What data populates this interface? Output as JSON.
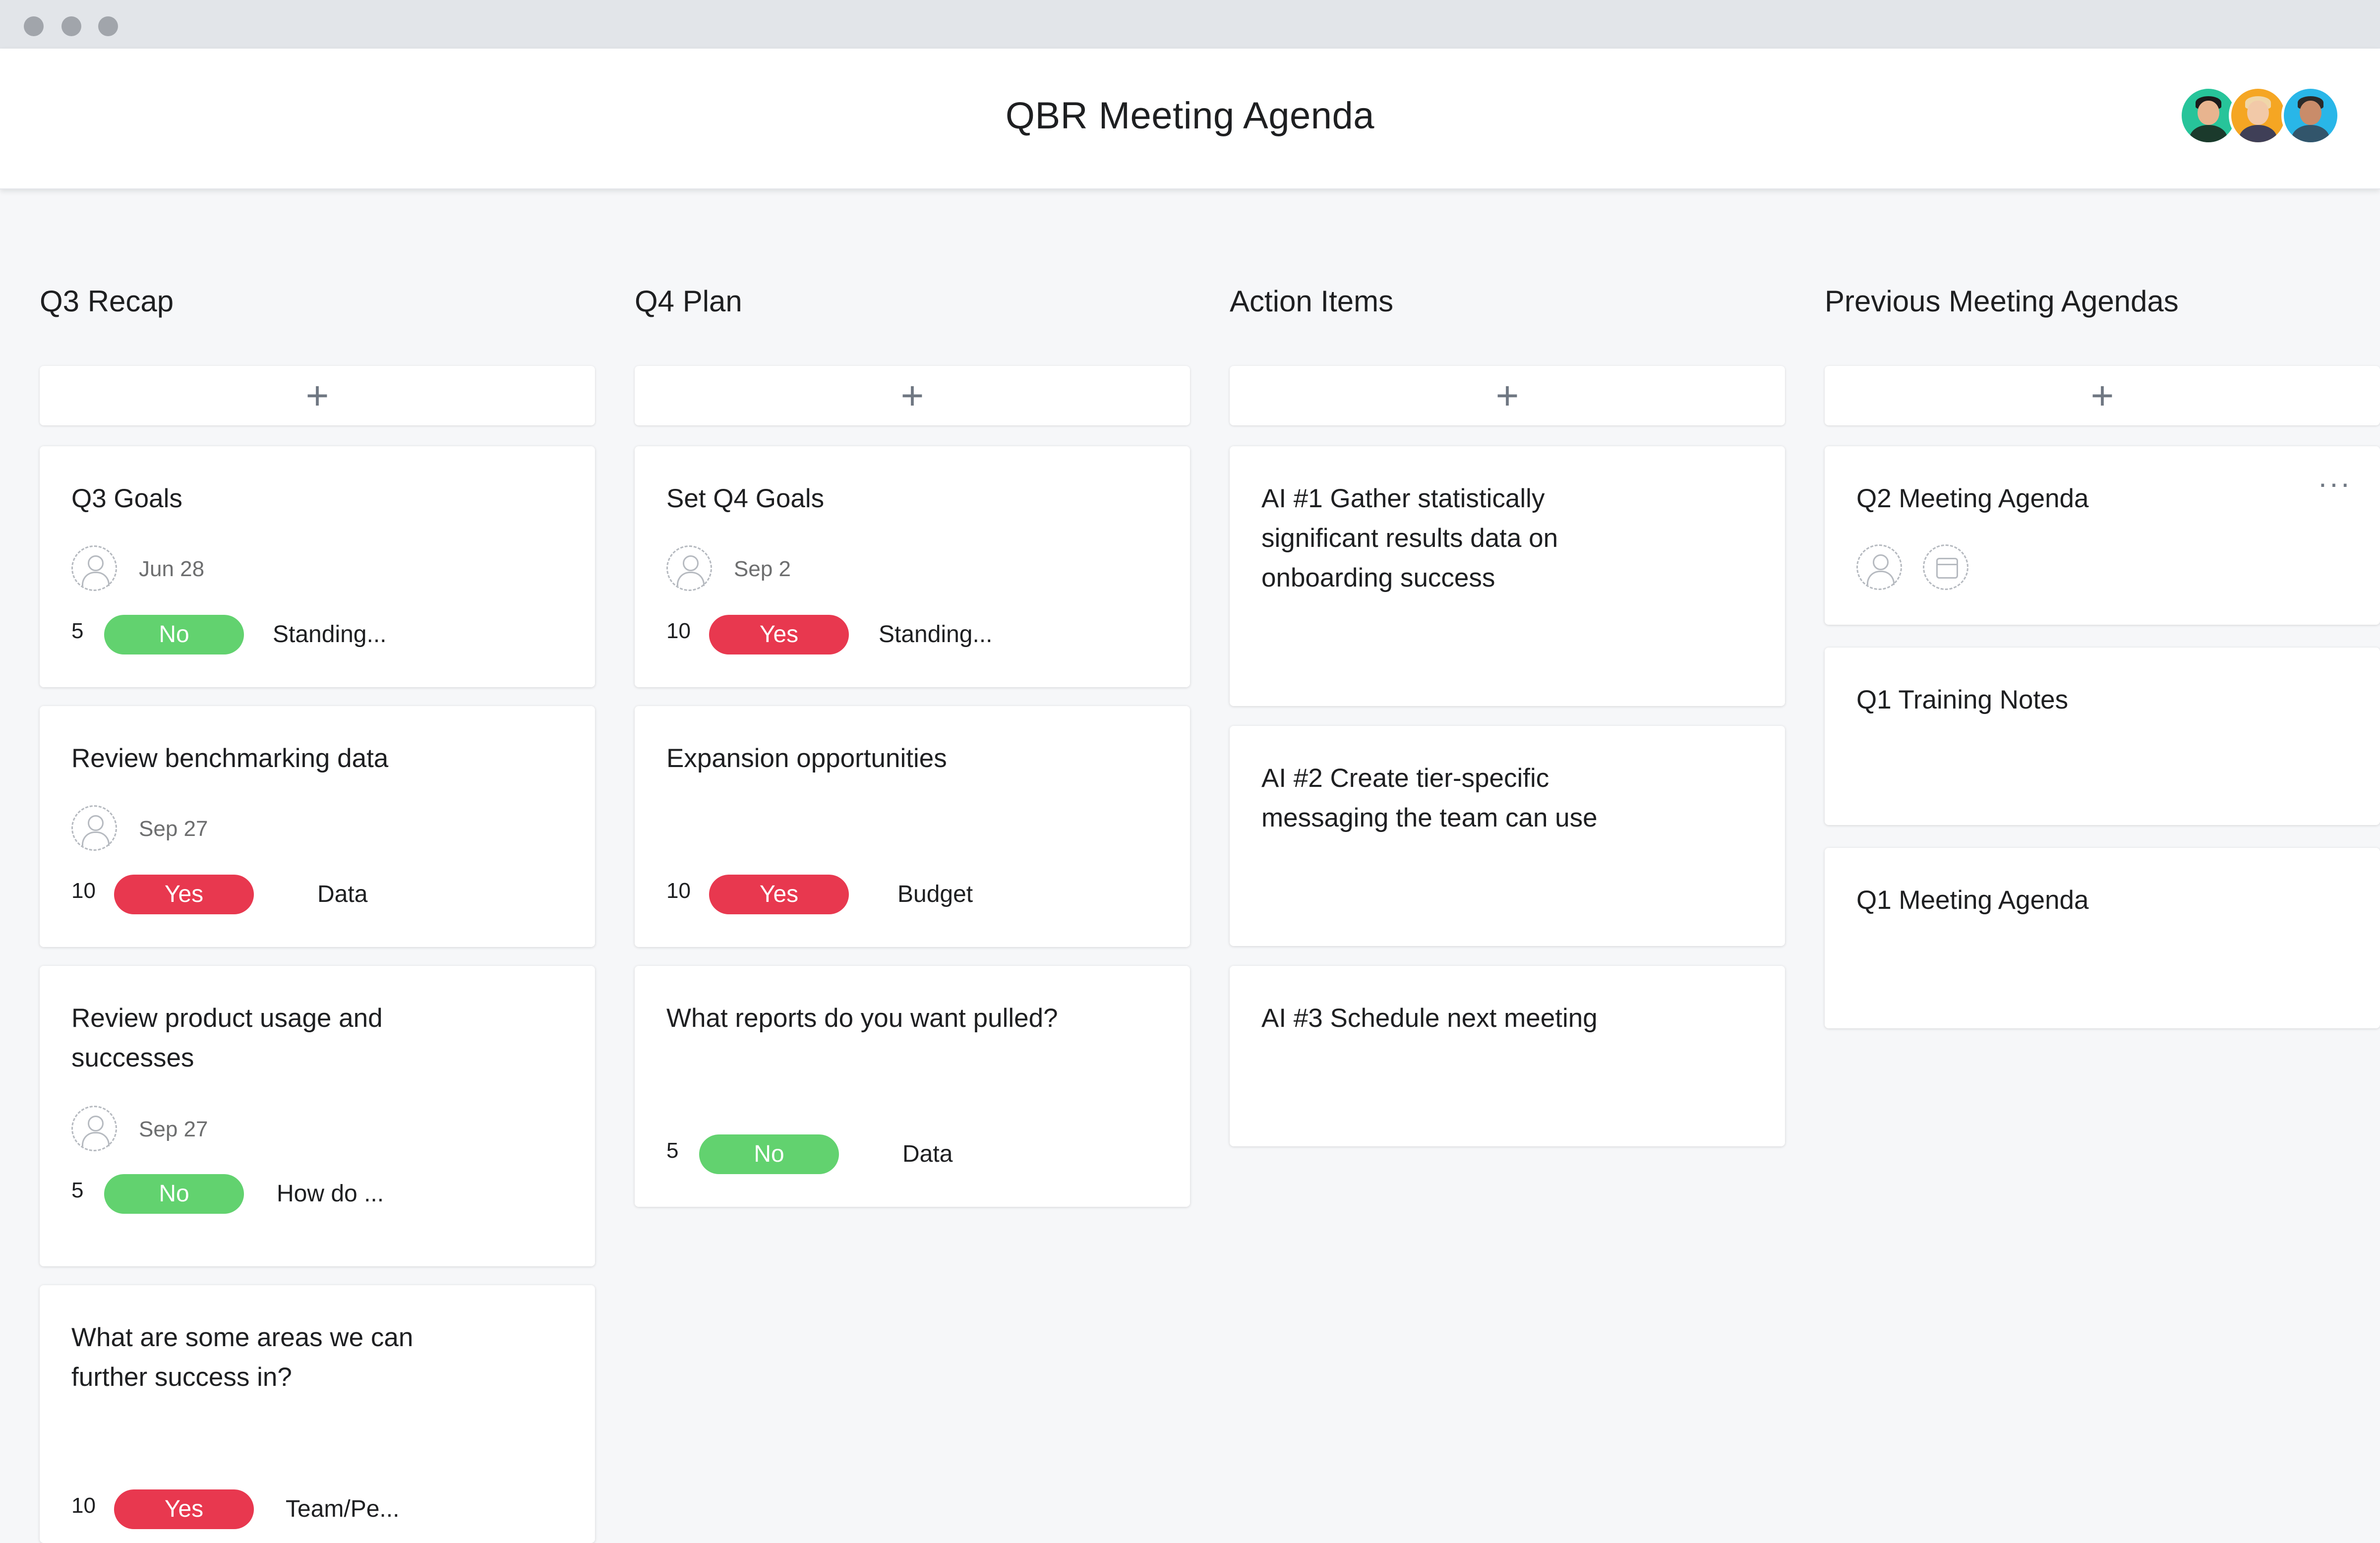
{
  "app": {
    "title": "QBR Meeting Agenda"
  },
  "header": {
    "avatars": [
      {
        "name": "avatar-1",
        "bg": "#27c49a",
        "hair": "#1b1b1b"
      },
      {
        "name": "avatar-2",
        "bg": "#f5a623",
        "hair": "#f0d6a8"
      },
      {
        "name": "avatar-3",
        "bg": "#29b6e8",
        "hair": "#2a2a2a"
      }
    ]
  },
  "add_label": "+",
  "columns": [
    {
      "title": "Q3 Recap",
      "cards": [
        {
          "title": "Q3 Goals",
          "date": "Jun 28",
          "num": "5",
          "pill": "No",
          "tag": "Standing..."
        },
        {
          "title": "Review benchmarking data",
          "date": "Sep 27",
          "num": "10",
          "pill": "Yes",
          "tag": "Data"
        },
        {
          "title": "Review product usage and successes",
          "date": "Sep 27",
          "num": "5",
          "pill": "No",
          "tag": "How do ..."
        },
        {
          "title": "What are some areas we can further success in?",
          "num": "10",
          "pill": "Yes",
          "tag": "Team/Pe..."
        }
      ]
    },
    {
      "title": "Q4 Plan",
      "cards": [
        {
          "title": "Set Q4 Goals",
          "date": "Sep 2",
          "num": "10",
          "pill": "Yes",
          "tag": "Standing..."
        },
        {
          "title": "Expansion opportunities",
          "num": "10",
          "pill": "Yes",
          "tag": "Budget"
        },
        {
          "title": "What reports do you want pulled?",
          "num": "5",
          "pill": "No",
          "tag": "Data"
        }
      ]
    },
    {
      "title": "Action Items",
      "cards": [
        {
          "title": "AI #1 Gather statistically significant results data on onboarding success"
        },
        {
          "title": "AI #2 Create tier-specific messaging the team can use"
        },
        {
          "title": "AI #3 Schedule next meeting"
        }
      ]
    },
    {
      "title": "Previous Meeting Agendas",
      "cards": [
        {
          "title": "Q2 Meeting Agenda",
          "more": "..."
        },
        {
          "title": "Q1 Training Notes"
        },
        {
          "title": "Q1 Meeting Agenda"
        }
      ]
    }
  ]
}
